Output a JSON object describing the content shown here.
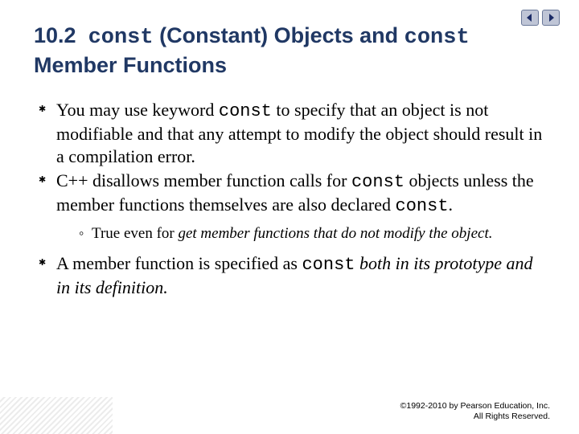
{
  "title": {
    "section_number": "10.2",
    "code1": "const",
    "part1": "(Constant) Objects and",
    "code2": "const",
    "part2": "Member Functions"
  },
  "bullets": {
    "b1_pre": "You may use keyword ",
    "b1_code": "const",
    "b1_post": " to specify that an object is not modifiable and that any attempt to modify the object should result in a compilation error.",
    "b2_pre": "C++ disallows member function calls for ",
    "b2_code": "const",
    "b2_mid": " objects unless the member functions themselves are also declared ",
    "b2_code2": "const",
    "b2_post": ".",
    "b2_sub_pre": "True even for ",
    "b2_sub_italic": "get member functions that do not modify the object.",
    "b3_pre": "A member function is specified as ",
    "b3_code": "const",
    "b3_mid": " ",
    "b3_italic": "both in its prototype and in its definition.",
    "b3_post": ""
  },
  "footer": {
    "line1": "©1992-2010 by Pearson Education, Inc.",
    "line2": "All Rights Reserved."
  },
  "nav": {
    "prev": "prev",
    "next": "next"
  }
}
